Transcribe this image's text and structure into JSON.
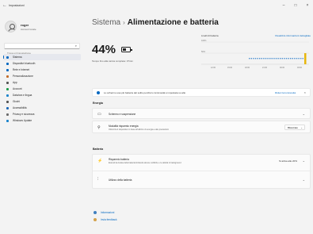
{
  "window": {
    "title": "Impostazioni",
    "minimize": "–",
    "maximize": "□",
    "close": "×"
  },
  "user": {
    "name": "roger",
    "account": "Account locale"
  },
  "search": {
    "placeholder": "Trova un'impostazione"
  },
  "nav": [
    {
      "label": "Sistema",
      "color": "#0067c0",
      "active": true
    },
    {
      "label": "Dispositivi bluetooth",
      "color": "#0067c0"
    },
    {
      "label": "Rete e Internet",
      "color": "#0067c0"
    },
    {
      "label": "Personalizzazione",
      "color": "#c26d2a"
    },
    {
      "label": "App",
      "color": "#555555"
    },
    {
      "label": "Account",
      "color": "#1c9c4a"
    },
    {
      "label": "Data/ora e lingua",
      "color": "#1a84cc"
    },
    {
      "label": "Giochi",
      "color": "#555555"
    },
    {
      "label": "Accessibilità",
      "color": "#1a66b5"
    },
    {
      "label": "Privacy e sicurezza",
      "color": "#6b6b6b"
    },
    {
      "label": "Windows Update",
      "color": "#1a84cc"
    }
  ],
  "breadcrumb": {
    "parent": "Sistema",
    "separator": "›",
    "current": "Alimentazione e batteria"
  },
  "battery": {
    "percent": "44%",
    "estimate": "Tempo fino alla carica completa: 37min"
  },
  "graph": {
    "label": "Livelli di batteria",
    "link": "Visualizza informazioni dettagliate",
    "y_ticks": [
      "100%",
      "50%"
    ],
    "x_ticks": [
      "12:00",
      "15:00",
      "18:00",
      "21:00",
      "00:00",
      "03:00"
    ]
  },
  "notice": {
    "text": "Lo schermo usa più batteria del solito perché lo luminosità è impostata su alto",
    "link": "Riduci la luminosità",
    "close": "×"
  },
  "energia": {
    "title": "Energia",
    "screen_sleep": "Schermo e sospensione",
    "power_mode": {
      "title": "Modalità risparmio energia",
      "sub": "Ottimizza il dispositivo in base all'utilizzo di energia e alle prestazioni",
      "value": "Bilanciato"
    }
  },
  "batteria": {
    "title": "Batteria",
    "saver": {
      "title": "Risparmio batteria",
      "sub": "Estendi la durata della batteria limitando alcune notifiche e le attività in background",
      "value": "Si attiva alle 20%"
    },
    "usage": "Utilizzo della batteria"
  },
  "links": {
    "help": "Informazioni",
    "feedback": "Invia feedback"
  },
  "colors": {
    "accent": "#0067c0",
    "background": "#f3f3f3",
    "graph_now": "#e7b60c"
  }
}
